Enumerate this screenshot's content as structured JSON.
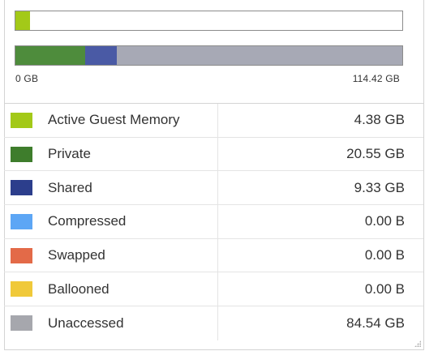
{
  "scale": {
    "min_label": "0 GB",
    "max_label": "114.42 GB",
    "max_gb": 114.42
  },
  "active_bar": {
    "value_gb": 4.38,
    "color": "#a3c918"
  },
  "usage_bar": {
    "background": "#a7a9b5",
    "segments": [
      {
        "name": "Private",
        "value_gb": 20.55,
        "color": "#4e8c3c"
      },
      {
        "name": "Shared",
        "value_gb": 9.33,
        "color": "#4a5aa5"
      },
      {
        "name": "Unaccessed",
        "value_gb": 84.54,
        "color": "#a7a9b5"
      }
    ]
  },
  "legend": [
    {
      "label": "Active Guest Memory",
      "value": "4.38 GB",
      "color": "#a3c918"
    },
    {
      "label": "Private",
      "value": "20.55 GB",
      "color": "#3e7d2c"
    },
    {
      "label": "Shared",
      "value": "9.33 GB",
      "color": "#2c3e8c"
    },
    {
      "label": "Compressed",
      "value": "0.00 B",
      "color": "#5da6f5"
    },
    {
      "label": "Swapped",
      "value": "0.00 B",
      "color": "#e36a48"
    },
    {
      "label": "Ballooned",
      "value": "0.00 B",
      "color": "#f0c93a"
    },
    {
      "label": "Unaccessed",
      "value": "84.54 GB",
      "color": "#a6a7ad"
    }
  ]
}
